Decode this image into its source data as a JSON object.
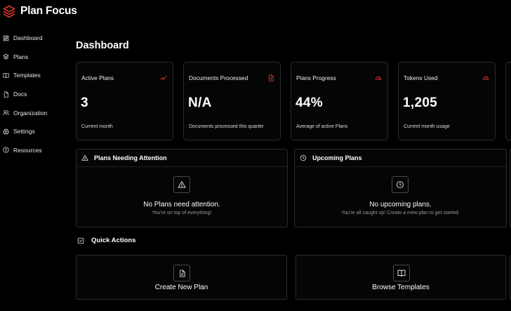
{
  "app": {
    "name": "Plan Focus",
    "brand_color": "#e03a2f"
  },
  "sidebar": {
    "items": [
      {
        "label": "Dashboard",
        "icon": "dashboard-icon"
      },
      {
        "label": "Plans",
        "icon": "layers-icon"
      },
      {
        "label": "Templates",
        "icon": "book-icon"
      },
      {
        "label": "Docs",
        "icon": "file-icon"
      },
      {
        "label": "Organization",
        "icon": "users-icon"
      },
      {
        "label": "Settings",
        "icon": "gear-icon"
      },
      {
        "label": "Resources",
        "icon": "help-icon"
      }
    ]
  },
  "page": {
    "title": "Dashboard"
  },
  "stats": [
    {
      "title": "Active Plans",
      "value": "3",
      "sub": "Current month",
      "icon": "trend-icon"
    },
    {
      "title": "Documents Processed",
      "value": "N/A",
      "sub": "Documents processed this quarter",
      "icon": "document-icon"
    },
    {
      "title": "Plans Progress",
      "value": "44%",
      "sub": "Average of active Plans",
      "icon": "gauge-icon"
    },
    {
      "title": "Tokens Used",
      "value": "1,205",
      "sub": "Current month usage",
      "icon": "gauge-icon"
    }
  ],
  "attention": {
    "title": "Plans Needing Attention",
    "empty_title": "No Plans need attention.",
    "empty_sub": "You're on top of everything!"
  },
  "upcoming": {
    "title": "Upcoming Plans",
    "empty_title": "No upcoming plans.",
    "empty_sub": "You're all caught up! Create a mew plan to get started."
  },
  "quick_actions": {
    "title": "Quick Actions",
    "items": [
      {
        "label": "Create New Plan",
        "icon": "file-plus-icon"
      },
      {
        "label": "Browse Templates",
        "icon": "book-open-icon"
      }
    ]
  },
  "accent": "#d93a2e"
}
